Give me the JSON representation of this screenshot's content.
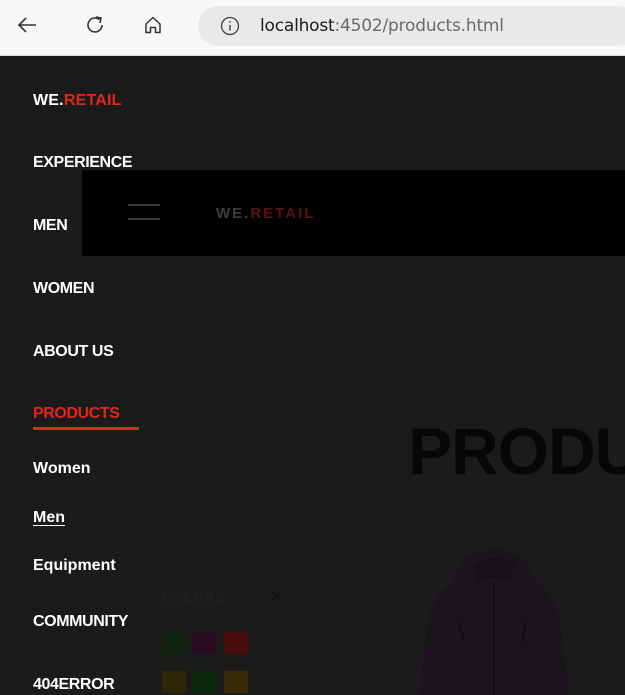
{
  "browser": {
    "url_host": "localhost",
    "url_rest": ":4502/products.html"
  },
  "header": {
    "logo_we": "WE.",
    "logo_retail": "RETAIL"
  },
  "page": {
    "title": "PRODU"
  },
  "filter": {
    "title": "COLORS",
    "close": "✕",
    "swatch_colors": [
      "#0e2410",
      "#2a0b22",
      "#4a0d0d",
      "#2e2608",
      "#0b2a0c",
      "#3a2a08"
    ]
  },
  "menu": {
    "logo_we": "WE.",
    "logo_retail": "RETAIL",
    "items": [
      "EXPERIENCE",
      "MEN",
      "WOMEN",
      "ABOUT US",
      "PRODUCTS"
    ],
    "sub_items": [
      "Women",
      "Men",
      "Equipment"
    ],
    "items_after": [
      "COMMUNITY",
      "404ERROR"
    ]
  },
  "colors": {
    "accent": "#e1251b",
    "menu_bg": "#1b1b1b"
  }
}
